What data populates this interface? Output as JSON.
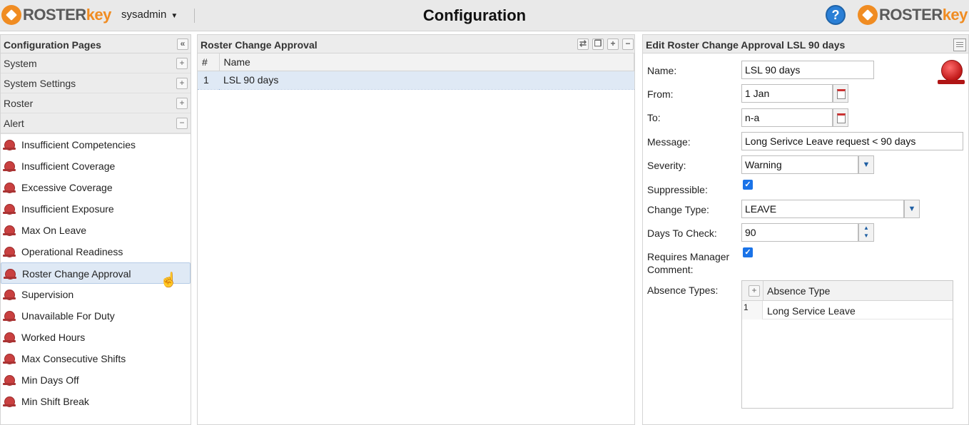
{
  "app": {
    "logo_left": {
      "roster": "ROSTER",
      "key": "key"
    },
    "logo_right": {
      "roster": "ROSTER",
      "key": "key"
    },
    "user": "sysadmin",
    "title": "Configuration",
    "help_label": "?"
  },
  "left_panel": {
    "title": "Configuration Pages",
    "groups": [
      {
        "label": "System",
        "state": "+"
      },
      {
        "label": "System Settings",
        "state": "+"
      },
      {
        "label": "Roster",
        "state": "+"
      },
      {
        "label": "Alert",
        "state": "−"
      }
    ],
    "items": [
      "Insufficient Competencies",
      "Insufficient Coverage",
      "Excessive Coverage",
      "Insufficient Exposure",
      "Max On Leave",
      "Operational Readiness",
      "Roster Change Approval",
      "Supervision",
      "Unavailable For Duty",
      "Worked Hours",
      "Max Consecutive Shifts",
      "Min Days Off",
      "Min Shift Break"
    ],
    "selected_index": 6
  },
  "mid_panel": {
    "title": "Roster Change Approval",
    "columns": [
      "#",
      "Name"
    ],
    "rows": [
      {
        "num": "1",
        "name": "LSL 90 days"
      }
    ]
  },
  "right_panel": {
    "title": "Edit Roster Change Approval LSL 90 days",
    "labels": {
      "name": "Name:",
      "from": "From:",
      "to": "To:",
      "message": "Message:",
      "severity": "Severity:",
      "suppressible": "Suppressible:",
      "change_type": "Change Type:",
      "days_to_check": "Days To Check:",
      "requires_mgr_1": "Requires Manager",
      "requires_mgr_2": "Comment:",
      "absence_types": "Absence Types:"
    },
    "values": {
      "name": "LSL 90 days",
      "from": "1 Jan",
      "to": "n-a",
      "message": "Long Serivce Leave request < 90 days",
      "severity": "Warning",
      "suppressible": true,
      "change_type": "LEAVE",
      "days_to_check": "90",
      "requires_manager_comment": true
    },
    "absence_grid": {
      "column": "Absence Type",
      "rows": [
        {
          "num": "1",
          "value": "Long Service Leave"
        }
      ]
    }
  }
}
